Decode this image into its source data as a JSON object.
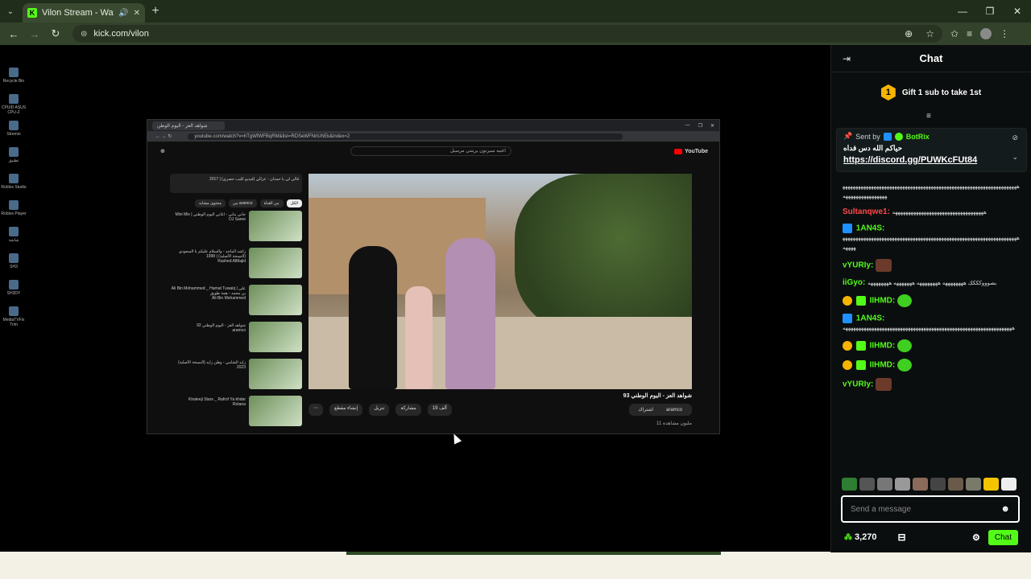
{
  "browser": {
    "tab_title": "Vilon Stream - Watch Live o",
    "tab_favicon": "K",
    "url": "kick.com/vilon",
    "accent": "#53fc18"
  },
  "embedded_video": {
    "tab": "شواهد العز - اليوم الوطن",
    "url": "youtube.com/watch?v=hTgWfWFBqRM&list=RDSeWFNriUhEk&index=2",
    "search_text": "اغنيه سبرتون يريتني مرسيل",
    "yt_logo": "YouTube",
    "video_title": "شواهد العز - اليوم الوطني 93",
    "channel": "aramco",
    "like_count": "19 ألف",
    "views": "11 مليون مشاهدة",
    "actions": [
      "مشاركة",
      "تنزيل",
      "إنشاء مقطع"
    ],
    "subscribe": "اشتراك",
    "playlist_title": "قالي لي يا حمدان - عزالي (فيديو كليب حصري) | 2017",
    "chips": [
      "الكل",
      "من القناة",
      "من aramco",
      "محتوى مشابه"
    ],
    "recs": [
      {
        "title": "Mini Mix | جاني بنابي - اغاني اليوم الوطني",
        "meta": "DJ Saree"
      },
      {
        "title": "راشد الماجد - والسلام عليكم يا السعودي (النسخة الأصلية) | 1998",
        "meta": "Rashed AlMajid"
      },
      {
        "title": "Ali Bin Mohammed _ Hamat Tuwaiq | علي بن محمد - همة طويق",
        "meta": "Ali Bin Mohammed"
      },
      {
        "title": "شواهد العز - اليوم الوطني 92",
        "meta": "aramco"
      },
      {
        "title": "زايد الشامي - وطن زايد (النسخة الأصلية) 2023",
        "meta": ""
      },
      {
        "title": "Khaleeji Stars _ Rafrof Ya khdar",
        "meta": "Rotana"
      }
    ]
  },
  "chat": {
    "title": "Chat",
    "gift_badge": "1",
    "gift_text": "Gift 1 sub to take 1st",
    "pinned": {
      "sent_by": "Sent by",
      "bot_name": "BotRix",
      "message": "حياكم الله دس فداه",
      "link": "https://discord.gg/PUWKcFUt84"
    },
    "messages": [
      {
        "user": "",
        "color": "#ffffff",
        "text": "ههههههههههههههههههههههههههههههههههههههههههههههههههههههههههههههههههههههههههههههههههههه"
      },
      {
        "user": "Sultanqwe1:",
        "color": "#ff4a4a",
        "text": "هههههههههههههههههههههههههههههههههههه"
      },
      {
        "user": "1AN4S:",
        "color": "#53fc18",
        "text": "ههههههههههههههههههههههههههههههههههههههههههههههههههههههههههههههههههههههههه"
      },
      {
        "user": "vYURIy:",
        "color": "#53fc18",
        "text": ""
      },
      {
        "user": "iiGyo:",
        "color": "#53fc18",
        "text": "بصوووكككك ههههههههه ههههههههه هههههههه ههههههههه"
      },
      {
        "user": "IIHMD:",
        "color": "#53fc18",
        "text": ""
      },
      {
        "user": "1AN4S:",
        "color": "#53fc18",
        "text": "هههههههههههههههههههههههههههههههههههههههههههههههههههههههههههههههههه"
      },
      {
        "user": "IIHMD:",
        "color": "#53fc18",
        "text": ""
      },
      {
        "user": "IIHMD:",
        "color": "#53fc18",
        "text": ""
      },
      {
        "user": "vYURIy:",
        "color": "#53fc18",
        "text": ""
      }
    ],
    "input_placeholder": "Send a message",
    "points": "3,270",
    "chat_button": "Chat"
  }
}
